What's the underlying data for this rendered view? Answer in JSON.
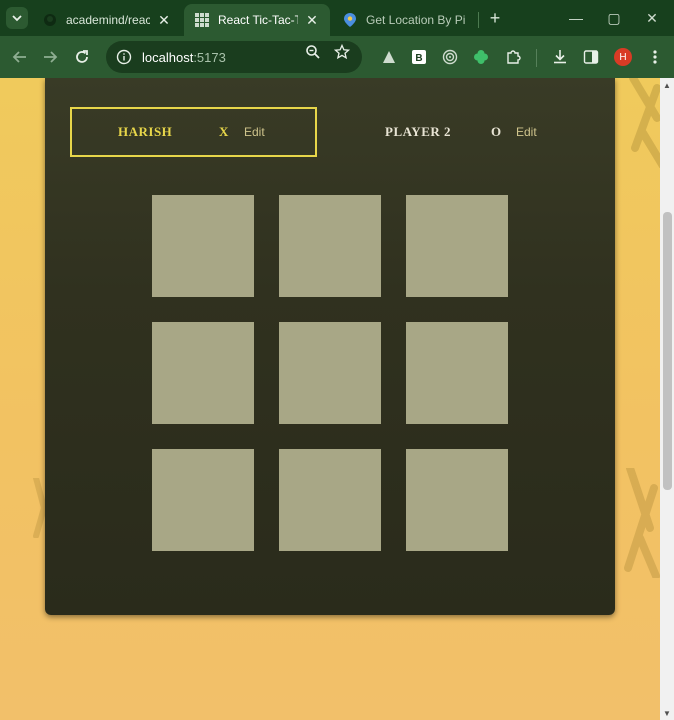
{
  "browser": {
    "tabs": [
      {
        "title": "academind/react-c",
        "active": false,
        "favicon": "github-icon"
      },
      {
        "title": "React Tic-Tac-Toe",
        "active": true,
        "favicon": "grid-icon"
      },
      {
        "title": "Get Location By Pi",
        "active": false,
        "favicon": "map-pin-icon"
      }
    ],
    "url_host": "localhost",
    "url_port": ":5173",
    "profile_initial": "H"
  },
  "game": {
    "players": [
      {
        "name": "HARISH",
        "symbol": "X",
        "edit_label": "Edit",
        "active": true
      },
      {
        "name": "PLAYER 2",
        "symbol": "O",
        "edit_label": "Edit",
        "active": false
      }
    ],
    "board": [
      [
        "",
        "",
        ""
      ],
      [
        "",
        "",
        ""
      ],
      [
        "",
        "",
        ""
      ]
    ]
  },
  "colors": {
    "active_player_border": "#e7d64a",
    "active_player_text": "#e7d64a",
    "inactive_player_text": "#e8e4d4",
    "cell": "#a8a786",
    "container": "#30311f",
    "background": "#f0ca5c"
  }
}
